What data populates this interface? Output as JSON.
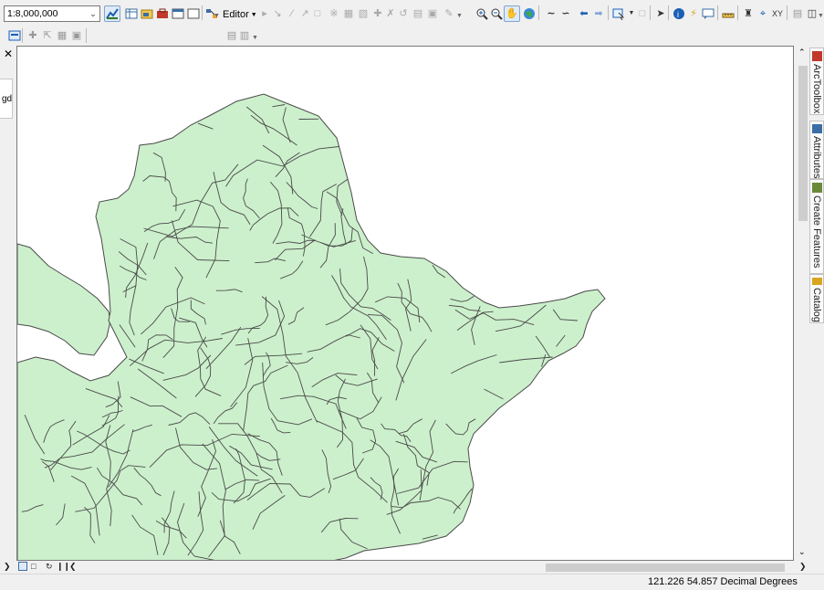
{
  "toolbar": {
    "scale_value": "1:8,000,000",
    "editor_label": "Editor",
    "icons": [
      "add-data-icon",
      "table-icon",
      "catalog-icon",
      "toolbox-icon",
      "python-icon",
      "model-icon",
      "editor-arrow-icon",
      "edit-tool-icon",
      "sketch-icon",
      "zoom-in-icon",
      "zoom-out-icon",
      "pan-icon",
      "full-extent-icon",
      "fixed-zoom-in-icon",
      "fixed-zoom-out-icon",
      "back-icon",
      "forward-icon",
      "select-features-icon",
      "clear-selection-icon",
      "select-elements-icon",
      "identify-icon",
      "hyperlink-icon",
      "html-popup-icon",
      "measure-icon",
      "find-icon",
      "find-route-icon",
      "go-to-xy-icon",
      "time-slider-icon",
      "create-viewer-icon"
    ]
  },
  "toc": {
    "fragment_text": "gd"
  },
  "dock": {
    "tabs": [
      {
        "label": "ArcToolbox",
        "icon": "toolbox-icon",
        "color": "#c0392b"
      },
      {
        "label": "Attributes",
        "icon": "attributes-icon",
        "color": "#3a6ea5"
      },
      {
        "label": "Create Features",
        "icon": "create-features-icon",
        "color": "#6a8a3a"
      },
      {
        "label": "Catalog",
        "icon": "catalog-icon",
        "color": "#d9a520"
      }
    ]
  },
  "map": {
    "fill_color": "#ccf0cc",
    "stroke_color": "#4a4a4a"
  },
  "status": {
    "coordinates": "121.226  54.857 Decimal Degrees"
  }
}
